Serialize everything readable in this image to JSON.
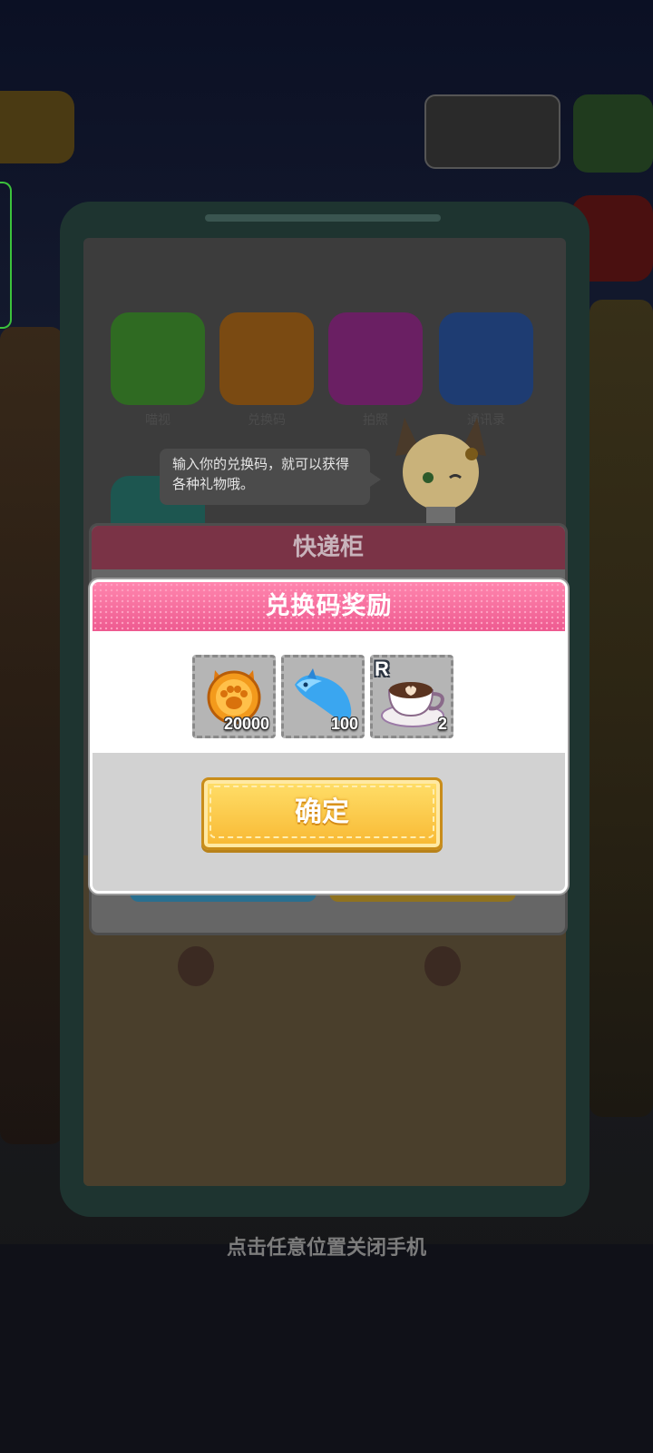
{
  "speech_bubble": {
    "text": "输入你的兑换码，就可以获得各种礼物哦。"
  },
  "phone": {
    "apps": [
      {
        "label": "喵视",
        "color": "#2f6a22"
      },
      {
        "label": "兑换码",
        "color": "#7a4a12"
      },
      {
        "label": "拍照",
        "color": "#6a1f63"
      },
      {
        "label": "通讯录",
        "color": "#1e3c72"
      },
      {
        "label": "",
        "color": "#1d5650"
      }
    ]
  },
  "locker_dialog": {
    "title": "快递柜"
  },
  "reward_dialog": {
    "title": "兑换码奖励",
    "items": [
      {
        "name": "paw-coin-icon",
        "quantity": "20000",
        "rarity": ""
      },
      {
        "name": "blue-fish-icon",
        "quantity": "100",
        "rarity": ""
      },
      {
        "name": "coffee-cup-icon",
        "quantity": "2",
        "rarity": "R"
      }
    ],
    "confirm_label": "确定"
  },
  "close_hint": "点击任意位置关闭手机"
}
